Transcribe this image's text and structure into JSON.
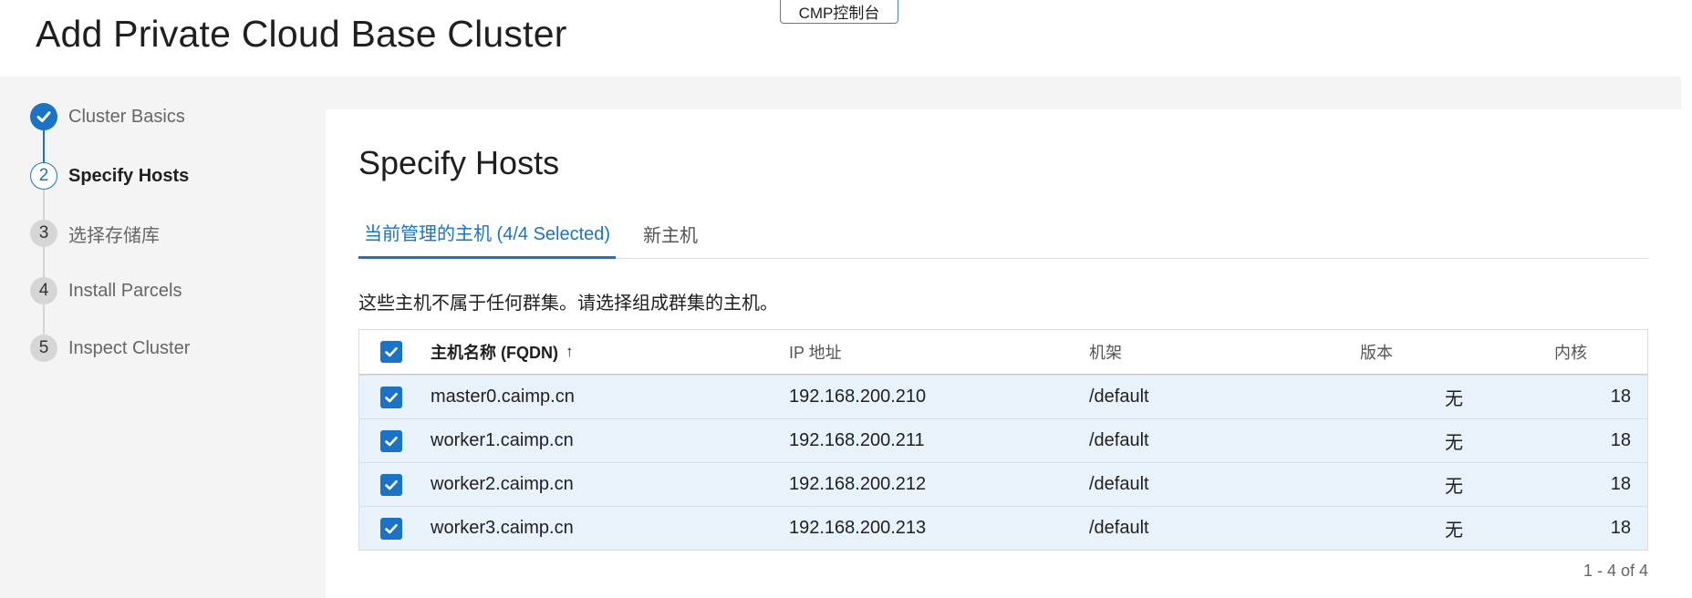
{
  "header": {
    "title": "Add Private Cloud Base Cluster",
    "cmp_button": "CMP控制台"
  },
  "stepper": {
    "steps": [
      {
        "number": "",
        "label": "Cluster Basics",
        "state": "done"
      },
      {
        "number": "2",
        "label": "Specify Hosts",
        "state": "current"
      },
      {
        "number": "3",
        "label": "选择存储库",
        "state": "pending"
      },
      {
        "number": "4",
        "label": "Install Parcels",
        "state": "pending"
      },
      {
        "number": "5",
        "label": "Inspect Cluster",
        "state": "pending"
      }
    ]
  },
  "main": {
    "title": "Specify Hosts",
    "tabs": [
      {
        "label": "当前管理的主机 (4/4 Selected)",
        "active": true
      },
      {
        "label": "新主机",
        "active": false
      }
    ],
    "description": "这些主机不属于任何群集。请选择组成群集的主机。"
  },
  "table": {
    "columns": {
      "fqdn": "主机名称 (FQDN)",
      "sort_indicator": "↑",
      "ip": "IP 地址",
      "rack": "机架",
      "version": "版本",
      "cores": "内核"
    },
    "rows": [
      {
        "selected": true,
        "fqdn": "master0.caimp.cn",
        "ip": "192.168.200.210",
        "rack": "/default",
        "version": "无",
        "cores": "18"
      },
      {
        "selected": true,
        "fqdn": "worker1.caimp.cn",
        "ip": "192.168.200.211",
        "rack": "/default",
        "version": "无",
        "cores": "18"
      },
      {
        "selected": true,
        "fqdn": "worker2.caimp.cn",
        "ip": "192.168.200.212",
        "rack": "/default",
        "version": "无",
        "cores": "18"
      },
      {
        "selected": true,
        "fqdn": "worker3.caimp.cn",
        "ip": "192.168.200.213",
        "rack": "/default",
        "version": "无",
        "cores": "18"
      }
    ],
    "pagination": "1 - 4 of 4"
  },
  "colors": {
    "accent": "#1a73c7",
    "selected_row": "#e8f2fb",
    "page_bg": "#f4f4f4"
  },
  "icons": {
    "step_done": "checkmark-icon",
    "checkbox": "checkbox-checked-icon",
    "sort": "arrow-up-icon"
  }
}
